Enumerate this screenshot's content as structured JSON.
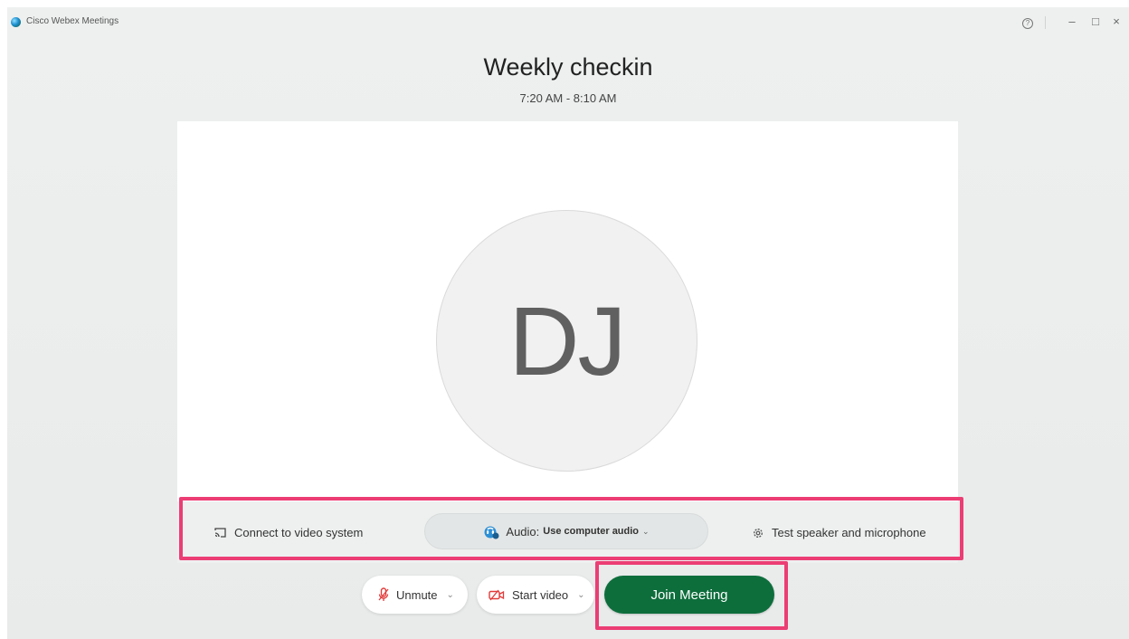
{
  "window": {
    "app_title": "Cisco Webex Meetings",
    "controls": {
      "help": "?",
      "minimize": "–",
      "maximize": "□",
      "close": "×"
    }
  },
  "meeting": {
    "title": "Weekly checkin",
    "time": "7:20 AM - 8:10 AM"
  },
  "preview": {
    "avatar_initials": "DJ"
  },
  "options": {
    "connect_label": "Connect to video system",
    "audio_label": "Audio:",
    "audio_value": "Use computer audio",
    "test_label": "Test speaker and microphone"
  },
  "controls": {
    "unmute_label": "Unmute",
    "video_label": "Start video",
    "join_label": "Join Meeting"
  },
  "colors": {
    "join_button": "#0d6e3c",
    "highlight": "#ec3d74"
  },
  "icons": [
    "app-logo-icon",
    "help-icon",
    "minimize-icon",
    "maximize-icon",
    "close-icon",
    "cast-icon",
    "audio-icon",
    "gear-icon",
    "microphone-muted-icon",
    "video-off-icon",
    "chevron-down-icon"
  ]
}
